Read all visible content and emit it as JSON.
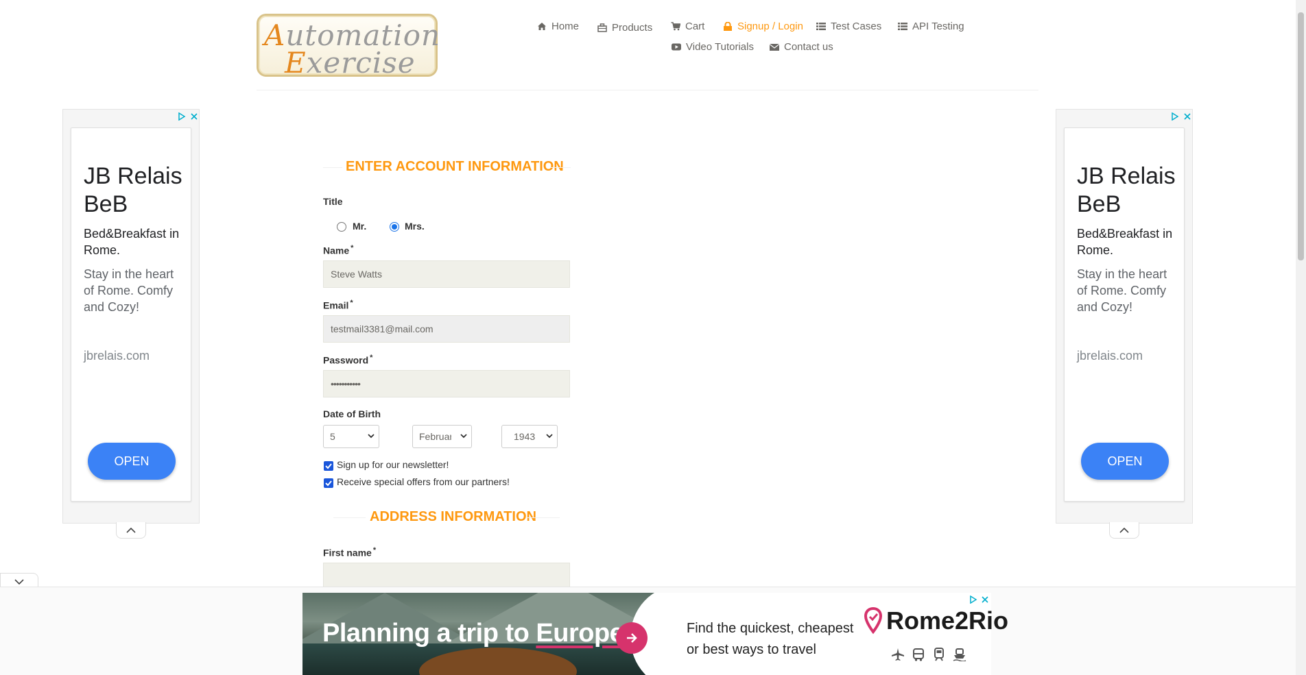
{
  "header": {
    "logo_line1": "Automation",
    "logo_line2": "Exercise",
    "nav": {
      "home": "Home",
      "products": "Products",
      "cart": "Cart",
      "signup": "Signup / Login",
      "test_cases": "Test Cases",
      "api_testing": "API Testing",
      "video_tutorials": "Video Tutorials",
      "contact_us": "Contact us"
    }
  },
  "side_ad": {
    "title": "JB Relais BeB",
    "subtitle": "Bed&Breakfast in Rome.",
    "body": "Stay in the heart of Rome. Comfy and Cozy!",
    "domain": "jbrelais.com",
    "open_label": "OPEN"
  },
  "form": {
    "account_title": "ENTER ACCOUNT INFORMATION",
    "title_label": "Title",
    "mr_label": "Mr.",
    "mrs_label": "Mrs.",
    "selected_title": "Mrs.",
    "name_label": "Name",
    "name_value": "Steve Watts",
    "email_label": "Email",
    "email_value": "testmail3381@mail.com",
    "password_label": "Password",
    "password_value": "•••••••••••",
    "dob_label": "Date of Birth",
    "dob_day": "5",
    "dob_month": "February",
    "dob_year": "1943",
    "newsletter_label": "Sign up for our newsletter!",
    "newsletter_checked": true,
    "offers_label": "Receive special offers from our partners!",
    "offers_checked": true,
    "address_title": "ADDRESS INFORMATION",
    "first_name_label": "First name",
    "required_marker": "*"
  },
  "bottom_ad": {
    "headline_part1": "Planning a trip to ",
    "headline_part2": "Europe?",
    "line1": "Find the quickest, cheapest",
    "line2": "or best ways to travel",
    "brand": "Rome2Rio"
  },
  "colors": {
    "accent": "#fe980f",
    "ad_button": "#3b82f6",
    "checkbox": "#1a56db",
    "brand_pink": "#d6336c"
  }
}
